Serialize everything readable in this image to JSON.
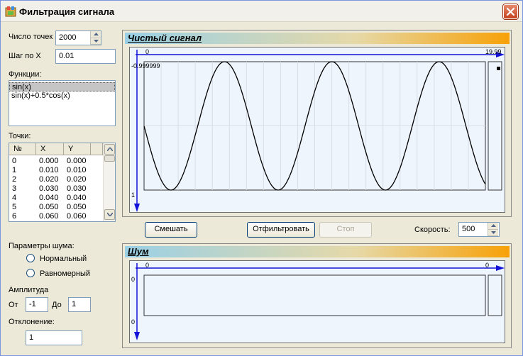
{
  "window": {
    "title": "Фильтрация сигнала"
  },
  "left": {
    "points_count_label": "Число точек",
    "points_count_value": "2000",
    "step_x_label": "Шаг по X",
    "step_x_value": "0.01",
    "functions_label": "Функции:",
    "functions": [
      "sin(x)",
      "sin(x)+0.5*cos(x)"
    ],
    "points_label": "Точки:",
    "table": {
      "headers": [
        "№",
        "X",
        "Y"
      ],
      "rows": [
        [
          "0",
          "0.000",
          "0.000"
        ],
        [
          "1",
          "0.010",
          "0.010"
        ],
        [
          "2",
          "0.020",
          "0.020"
        ],
        [
          "3",
          "0.030",
          "0.030"
        ],
        [
          "4",
          "0.040",
          "0.040"
        ],
        [
          "5",
          "0.050",
          "0.050"
        ],
        [
          "6",
          "0.060",
          "0.060"
        ]
      ]
    },
    "noise_params_label": "Параметры шума:",
    "radio_normal": "Нормальный",
    "radio_uniform": "Равномерный",
    "amplitude_label": "Амплитуда",
    "from_label": "От",
    "from_value": "-1",
    "to_label": "До",
    "to_value": "1",
    "deviation_label": "Отклонение:",
    "deviation_value": "1"
  },
  "clean_panel": {
    "title": "Чистый сигнал",
    "x_min_label": "0",
    "x_max_label": "19.99",
    "y_top_label": "-0.999999",
    "y_bottom_label": "1"
  },
  "controls": {
    "mix_button": "Смешать",
    "filter_button": "Отфильтровать",
    "stop_button": "Стоп",
    "speed_label": "Скорость:",
    "speed_value": "500"
  },
  "noise_panel": {
    "title": "Шум",
    "x_min_label": "0",
    "x_max_label": "0",
    "y_top_label": "0",
    "y_bottom_label": "0"
  },
  "chart_data": {
    "type": "line",
    "series": [
      {
        "function": "sin(x)",
        "x_range": [
          0,
          19.99
        ]
      }
    ],
    "xlim": [
      0,
      19.99
    ],
    "ylim": [
      -1,
      1
    ]
  },
  "colors": {
    "axis": "#1212d8",
    "curve": "#000000",
    "plot_bg": "#eef5fd",
    "grid": "#d8dde5"
  }
}
